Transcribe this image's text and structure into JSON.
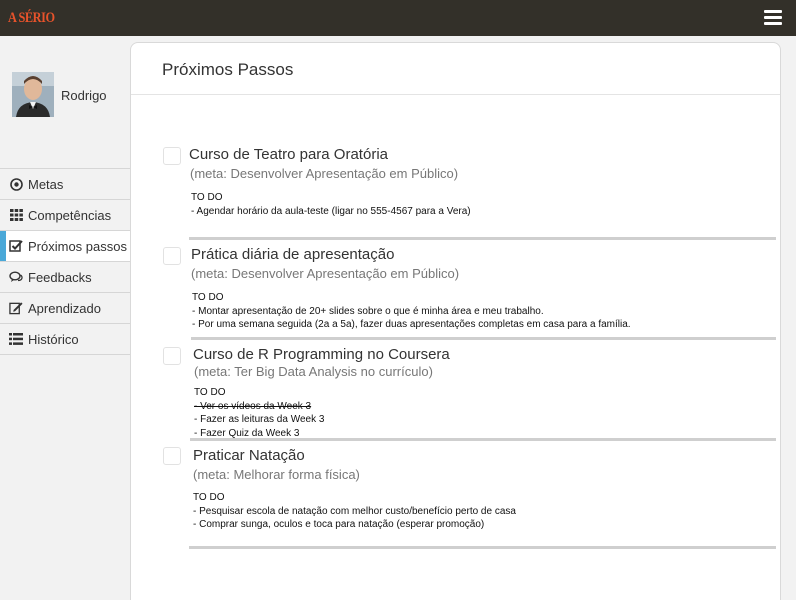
{
  "app": {
    "logo": "A SÉRIO"
  },
  "user": {
    "name": "Rodrigo"
  },
  "sidebar": {
    "items": [
      {
        "label": "Metas",
        "icon": "target-icon"
      },
      {
        "label": "Competências",
        "icon": "grid-icon"
      },
      {
        "label": "Próximos passos",
        "icon": "checkbox-icon",
        "active": true
      },
      {
        "label": "Feedbacks",
        "icon": "chat-bubbles-icon"
      },
      {
        "label": "Aprendizado",
        "icon": "edit-icon"
      },
      {
        "label": "Histórico",
        "icon": "list-icon"
      }
    ]
  },
  "main": {
    "title": "Próximos Passos",
    "tasks": [
      {
        "title": "Curso de Teatro para Oratória",
        "meta": "(meta: Desenvolver Apresentação em Público)",
        "todo_header": "TO DO",
        "items": [
          {
            "text": "- Agendar horário da aula-teste (ligar no 555-4567 para a Vera)",
            "done": false
          }
        ]
      },
      {
        "title": "Prática diária de apresentação",
        "meta": "(meta: Desenvolver Apresentação em Público)",
        "todo_header": "TO DO",
        "items": [
          {
            "text": "- Montar apresentação de 20+ slides sobre o que é minha área e meu trabalho.",
            "done": false
          },
          {
            "text": "- Por uma semana seguida (2a a 5a), fazer duas apresentações completas em casa para a família.",
            "done": false
          }
        ]
      },
      {
        "title": "Curso de R Programming no Coursera",
        "meta": "(meta: Ter Big Data Analysis no currículo)",
        "todo_header": "TO DO",
        "items": [
          {
            "text": "- Ver os vídeos da Week 3",
            "done": true
          },
          {
            "text": "- Fazer as leituras da Week 3",
            "done": false
          },
          {
            "text": "- Fazer Quiz da Week 3",
            "done": false
          }
        ]
      },
      {
        "title": "Praticar Natação",
        "meta": "(meta: Melhorar forma física)",
        "todo_header": "TO DO",
        "items": [
          {
            "text": "- Pesquisar escola de natação com melhor custo/benefício perto de casa",
            "done": false
          },
          {
            "text": "- Comprar sunga, oculos e toca para natação (esperar promoção)",
            "done": false
          }
        ]
      }
    ]
  }
}
